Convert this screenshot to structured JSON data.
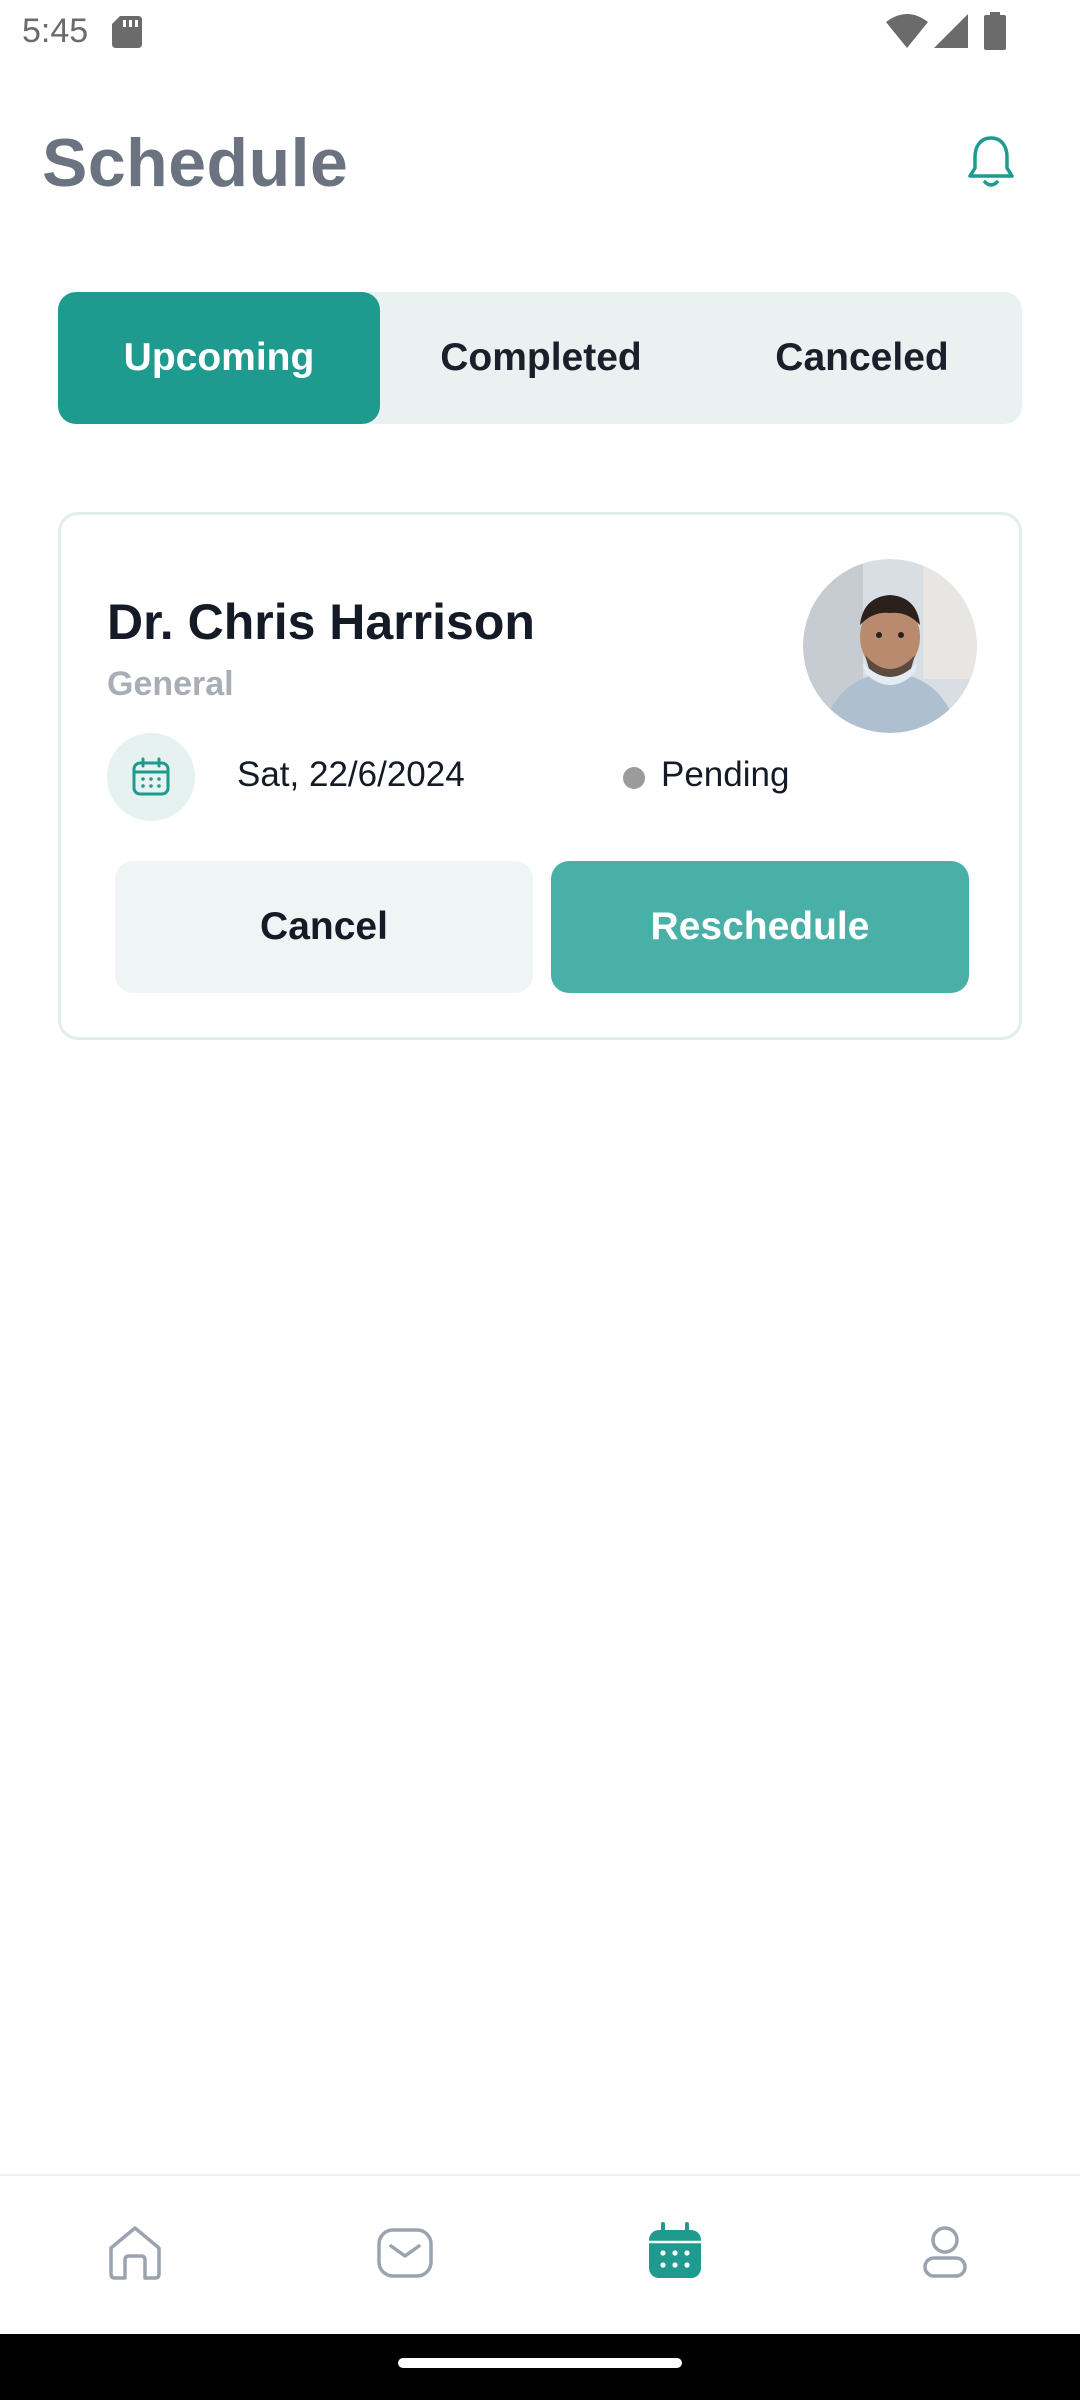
{
  "status_bar": {
    "time": "5:45"
  },
  "header": {
    "title": "Schedule",
    "notification_icon": "bell-icon"
  },
  "tabs": [
    {
      "label": "Upcoming",
      "active": true
    },
    {
      "label": "Completed",
      "active": false
    },
    {
      "label": "Canceled",
      "active": false
    }
  ],
  "appointment": {
    "doctor_name": "Dr. Chris Harrison",
    "specialty": "General",
    "date": "Sat, 22/6/2024",
    "status": "Pending",
    "status_color": "#9b9b9b",
    "cancel_label": "Cancel",
    "reschedule_label": "Reschedule"
  },
  "bottom_nav": [
    {
      "icon": "home-icon",
      "active": false
    },
    {
      "icon": "messages-icon",
      "active": false
    },
    {
      "icon": "calendar-icon",
      "active": true
    },
    {
      "icon": "profile-icon",
      "active": false
    }
  ],
  "colors": {
    "accent": "#1f9a8e",
    "accent_light": "#48b0a6",
    "title_gray": "#6b7280"
  }
}
